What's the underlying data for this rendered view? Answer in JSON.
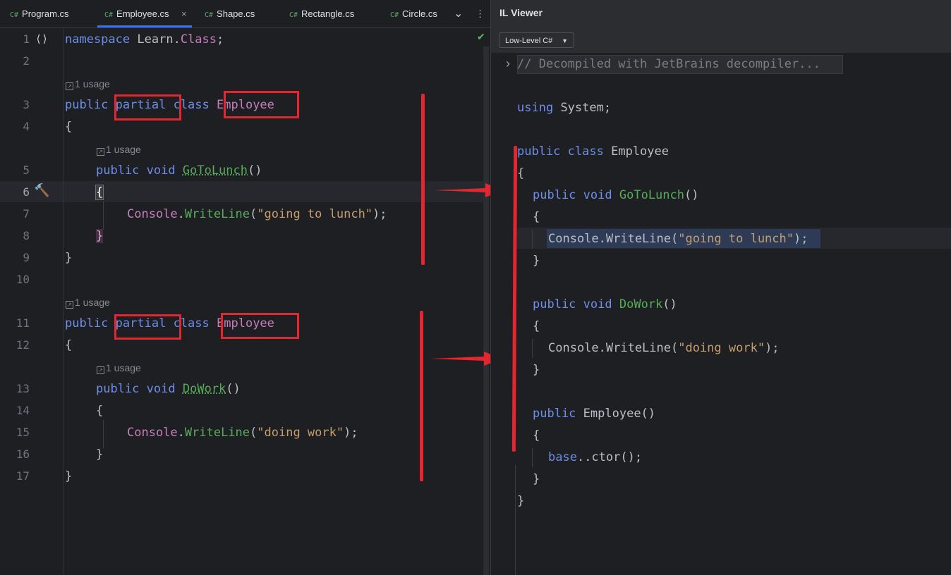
{
  "tabs": [
    {
      "prefix": "C#",
      "label": "Program.cs"
    },
    {
      "prefix": "C#",
      "label": "Employee.cs",
      "close": "×"
    },
    {
      "prefix": "C#",
      "label": "Shape.cs"
    },
    {
      "prefix": "C#",
      "label": "Rectangle.cs"
    },
    {
      "prefix": "C#",
      "label": "Circle.cs"
    }
  ],
  "tab_icons": {
    "more": "⌄",
    "menu": "⋮"
  },
  "editor": {
    "line_numbers": [
      "1",
      "2",
      "3",
      "4",
      "5",
      "6",
      "7",
      "8",
      "9",
      "10",
      "11",
      "12",
      "13",
      "14",
      "15",
      "16",
      "17"
    ],
    "usage_text": "1 usage",
    "usage_icon": "↗",
    "lines": {
      "l1": {
        "kw": "namespace",
        "ns1": "Learn",
        "dot": ".",
        "ns2": "Class",
        "semi": ";"
      },
      "l3": {
        "kw1": "public",
        "kw2": "partial",
        "kw3": "class",
        "name": "Employee"
      },
      "l4": "{",
      "l5": {
        "kw1": "public",
        "kw2": "void",
        "name": "GoToLunch",
        "parens": "()"
      },
      "l6": "{",
      "l7": {
        "obj": "Console",
        "dot": ".",
        "mth": "WriteLine",
        "open": "(",
        "str": "\"going to lunch\"",
        "close": ");"
      },
      "l8": "}",
      "l9": "}",
      "l11": {
        "kw1": "public",
        "kw2": "partial",
        "kw3": "class",
        "name": "Employee"
      },
      "l12": "{",
      "l13": {
        "kw1": "public",
        "kw2": "void",
        "name": "DoWork",
        "parens": "()"
      },
      "l14": "{",
      "l15": {
        "obj": "Console",
        "dot": ".",
        "mth": "WriteLine",
        "open": "(",
        "str": "\"doing work\"",
        "close": ");"
      },
      "l16": "}",
      "l17": "}"
    }
  },
  "il_viewer": {
    "title": "IL Viewer",
    "mode": "Low-Level C#",
    "fold_arrow": "›",
    "comment": "// Decompiled with JetBrains decompiler...",
    "using_kw": "using",
    "using_ns": "System;",
    "cls": {
      "kw1": "public",
      "kw2": "class",
      "name": "Employee"
    },
    "open_brace": "{",
    "close_brace": "}",
    "m1": {
      "kw1": "public",
      "kw2": "void",
      "name": "GoToLunch",
      "parens": "()",
      "body_obj": "Console.WriteLine(",
      "body_str": "\"going to lunch\"",
      "body_end": ");"
    },
    "m2": {
      "kw1": "public",
      "kw2": "void",
      "name": "DoWork",
      "parens": "()",
      "body_obj": "Console.WriteLine(",
      "body_str": "\"doing work\"",
      "body_end": ");"
    },
    "ctor": {
      "kw": "public",
      "name": "Employee()",
      "body_kw": "base",
      "body_rest": "..ctor();"
    }
  },
  "colors": {
    "annotation": "#e3262f",
    "accent": "#3574f0"
  }
}
